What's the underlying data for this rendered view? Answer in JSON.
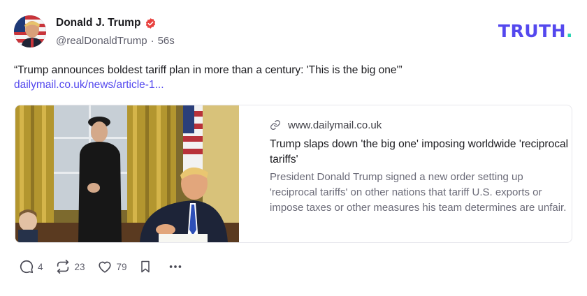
{
  "author": {
    "display_name": "Donald J. Trump",
    "handle": "@realDonaldTrump",
    "separator": "·",
    "time_ago": "56s",
    "verified_color": "#e8413e"
  },
  "brand": {
    "word": "TRUTH",
    "dot": ".",
    "color": "#5448ee",
    "dot_color": "#22d3b1"
  },
  "post": {
    "text": "“Trump announces boldest tariff plan in more than a century: 'This is the big one'”",
    "link": "dailymail.co.uk/news/article-1...",
    "link_color": "#5448ee"
  },
  "card": {
    "domain": "www.dailymail.co.uk",
    "title": "Trump slaps down 'the big one' imposing worldwide 'reciprocal tariffs'",
    "description": "President Donald Trump signed a new order setting up 'reciprocal tariffs' on other nations that tariff U.S. exports or impose taxes or other measures his team determines are unfair."
  },
  "actions": {
    "replies": "4",
    "retruths": "23",
    "likes": "79"
  },
  "icons": [
    "verified-badge-icon",
    "link-icon",
    "reply-icon",
    "retruth-icon",
    "heart-icon",
    "bookmark-icon",
    "more-icon"
  ]
}
